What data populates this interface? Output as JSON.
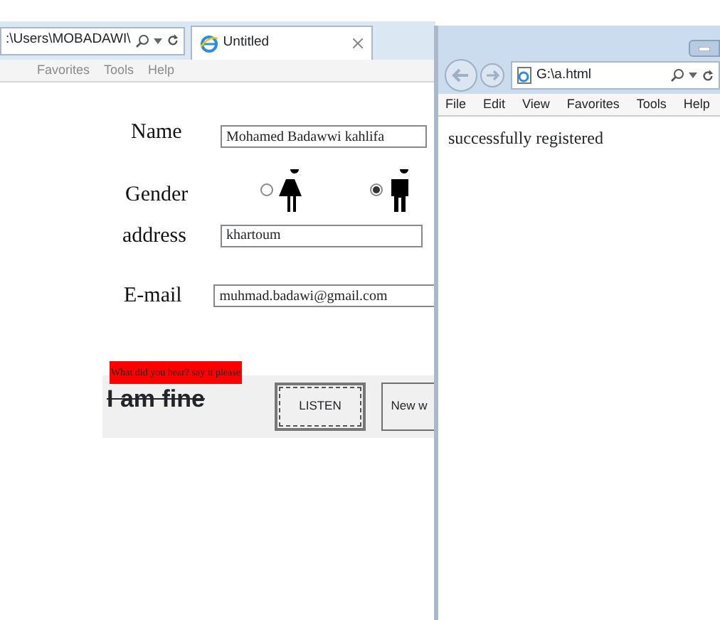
{
  "back_window": {
    "address": ":\\Users\\MOBADAWI\\",
    "tab": {
      "title": "Untitled"
    },
    "menu": [
      "Favorites",
      "Tools",
      "Help"
    ],
    "form": [
      {
        "kind": "text",
        "label": "Name",
        "value": "Mohamed Badawwi kahlifa"
      },
      {
        "kind": "gender",
        "label": "Gender",
        "options": [
          {
            "kind": "female",
            "selected": false
          },
          {
            "kind": "male",
            "selected": true
          }
        ]
      },
      {
        "kind": "text",
        "label": "address",
        "value": "khartoum"
      },
      {
        "kind": "text",
        "label": "E-mail",
        "value": "muhmad.badawi@gmail.com"
      }
    ],
    "prompt": "What did you hear? say it  please",
    "answer": "I am fine",
    "buttons": [
      "LISTEN",
      "New w"
    ]
  },
  "front_window": {
    "address": "G:\\a.html",
    "menu": [
      "File",
      "Edit",
      "View",
      "Favorites",
      "Tools",
      "Help"
    ],
    "message": "successfully registered"
  }
}
